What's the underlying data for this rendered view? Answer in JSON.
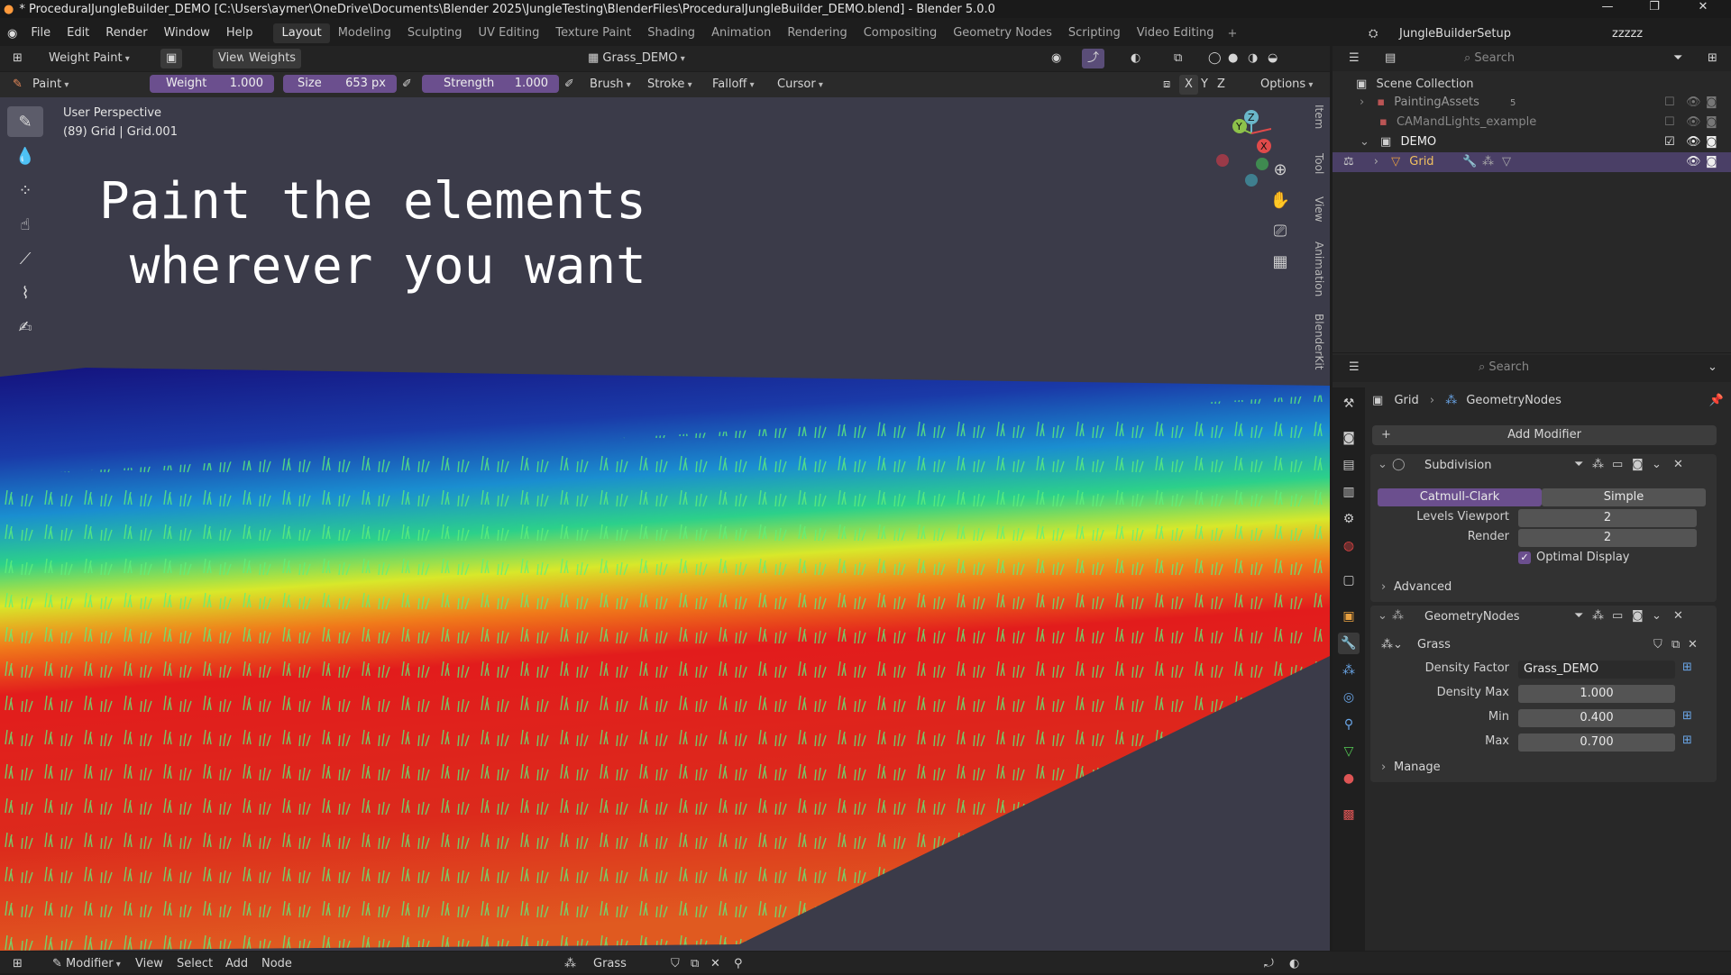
{
  "window": {
    "title": "* ProceduralJungleBuilder_DEMO [C:\\Users\\aymer\\OneDrive\\Documents\\Blender 2025\\JungleTesting\\BlenderFiles\\ProceduralJungleBuilder_DEMO.blend] - Blender 5.0.0",
    "minimize": "—",
    "maximize": "❐",
    "close": "✕"
  },
  "menu": [
    "File",
    "Edit",
    "Render",
    "Window",
    "Help"
  ],
  "workspaces": [
    "Layout",
    "Modeling",
    "Sculpting",
    "UV Editing",
    "Texture Paint",
    "Shading",
    "Animation",
    "Rendering",
    "Compositing",
    "Geometry Nodes",
    "Scripting",
    "Video Editing"
  ],
  "active_workspace": "Layout",
  "scene": {
    "name": "JungleBuilderSetup",
    "view_layer": "zzzzz"
  },
  "viewport_header": {
    "mode": "Weight Paint",
    "view": "View",
    "weights": "Weights",
    "vertex_group": "Grass_DEMO"
  },
  "tool_header": {
    "brush_name": "Paint",
    "weight_label": "Weight",
    "weight_value": "1.000",
    "size_label": "Size",
    "size_value": "653 px",
    "strength_label": "Strength",
    "strength_value": "1.000",
    "brush": "Brush",
    "stroke": "Stroke",
    "falloff": "Falloff",
    "cursor": "Cursor",
    "options": "Options",
    "axes": [
      "X",
      "Y",
      "Z"
    ]
  },
  "viewport": {
    "perspective": "User Perspective",
    "object_info": "(89) Grid | Grid.001",
    "overlay_line1": "Paint the elements",
    "overlay_line2": " wherever you want",
    "side_tabs": [
      "Item",
      "Tool",
      "View",
      "Animation",
      "BlenderKit"
    ],
    "gizmo_axes": [
      "Z",
      "Y",
      "X"
    ]
  },
  "outliner": {
    "search_placeholder": "Search",
    "root": "Scene Collection",
    "items": [
      {
        "label": "PaintingAssets",
        "extra": "5"
      },
      {
        "label": "CAMandLights_example"
      },
      {
        "label": "DEMO"
      },
      {
        "label": "Grid"
      }
    ]
  },
  "properties": {
    "search_placeholder": "Search",
    "breadcrumb_object": "Grid",
    "breadcrumb_modifier": "GeometryNodes",
    "add_modifier": "Add Modifier",
    "subdivision": {
      "name": "Subdivision",
      "catmull": "Catmull-Clark",
      "simple": "Simple",
      "levels_viewport_label": "Levels Viewport",
      "levels_viewport": "2",
      "render_label": "Render",
      "render": "2",
      "optimal_display": "Optimal Display",
      "advanced": "Advanced"
    },
    "geonodes": {
      "name": "GeometryNodes",
      "node_group": "Grass",
      "density_factor_label": "Density Factor",
      "density_factor": "Grass_DEMO",
      "density_max_label": "Density Max",
      "density_max": "1.000",
      "min_label": "Min",
      "min": "0.400",
      "max_label": "Max",
      "max": "0.700",
      "manage": "Manage"
    }
  },
  "bottom_bar": {
    "editor": "Modifier",
    "items": [
      "View",
      "Select",
      "Add",
      "Node"
    ],
    "node_group": "Grass"
  },
  "colors": {
    "accent": "#6b4f8e",
    "selection": "#4a3f66",
    "viewport_bg": "#3b3b49"
  }
}
